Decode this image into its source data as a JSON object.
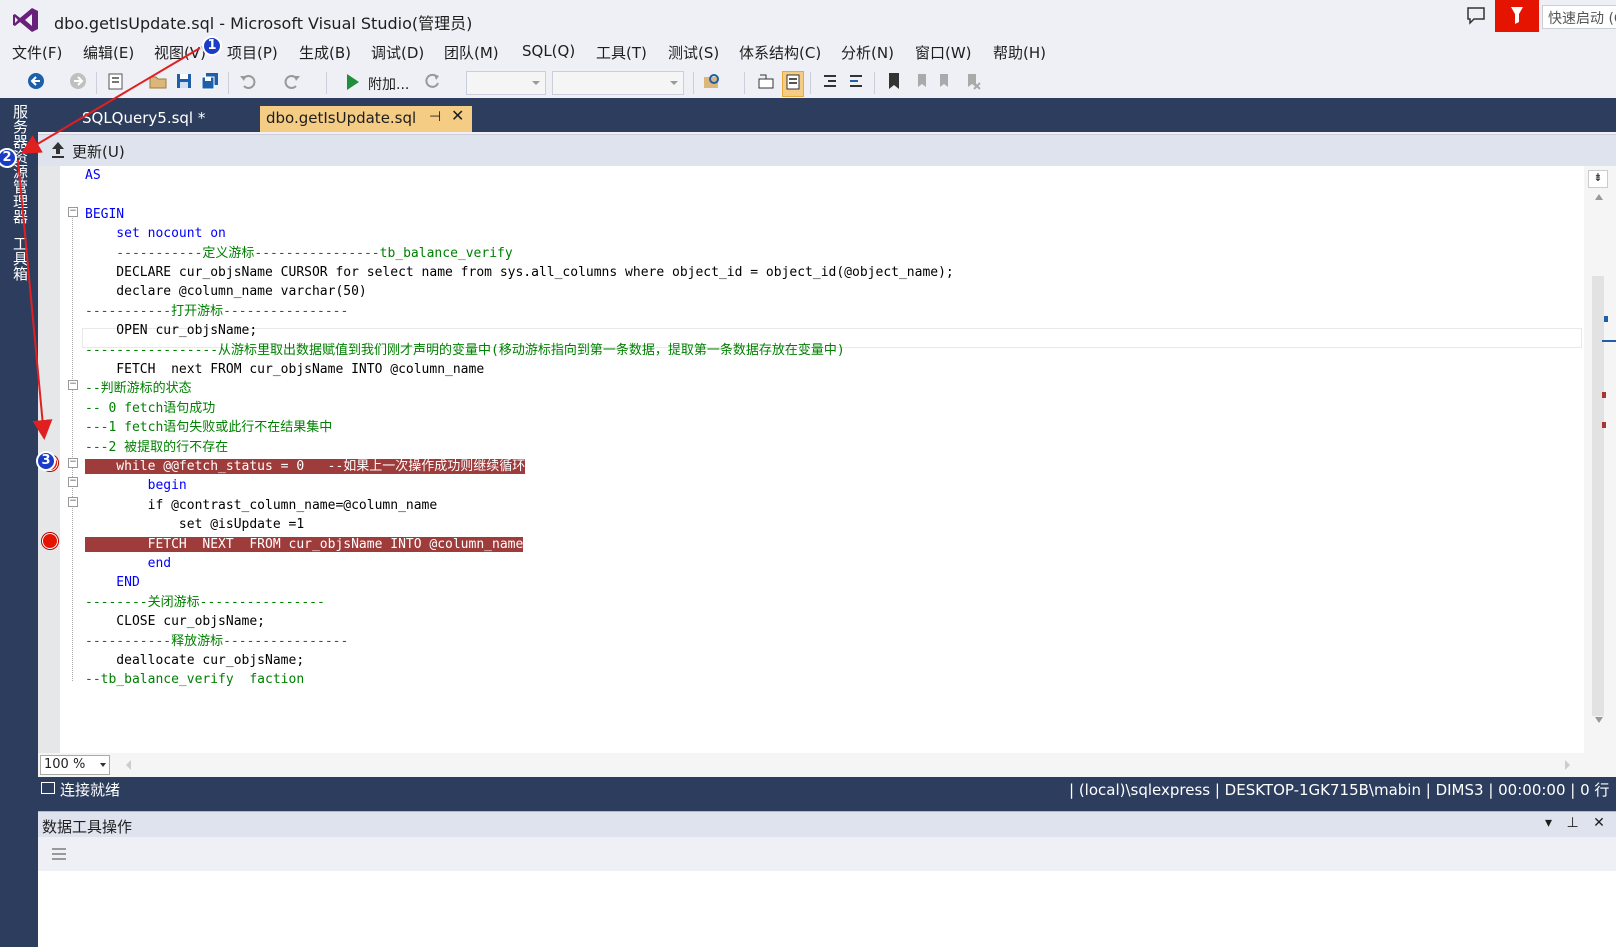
{
  "window": {
    "title": "dbo.getIsUpdate.sql  - Microsoft Visual Studio(管理员)"
  },
  "quick_launch": {
    "placeholder": "快速启动 (Ctrl+Q)"
  },
  "menu": [
    "文件(F)",
    "编辑(E)",
    "视图(V)",
    "项目(P)",
    "生成(B)",
    "调试(D)",
    "团队(M)",
    "SQL(Q)",
    "工具(T)",
    "测试(S)",
    "体系结构(C)",
    "分析(N)",
    "窗口(W)",
    "帮助(H)"
  ],
  "toolbar": {
    "attach_label": "附加..."
  },
  "side_tabs": {
    "server_explorer": "服务器资源管理器",
    "toolbox": "工具箱"
  },
  "tabs": {
    "inactive": "SQLQuery5.sql *",
    "active": "dbo.getIsUpdate.sql"
  },
  "update_bar": {
    "label": "更新(U)"
  },
  "code_lines": [
    "AS",
    "",
    "BEGIN",
    "    set nocount on",
    "    -----------定义游标----------------tb_balance_verify",
    "    DECLARE cur_objsName CURSOR for select name from sys.all_columns where object_id = object_id(@object_name);",
    "    declare @column_name varchar(50)",
    "-----------打开游标----------------",
    "    OPEN cur_objsName;",
    "-----------------从游标里取出数据赋值到我们刚才声明的变量中(移动游标指向到第一条数据，提取第一条数据存放在变量中)",
    "    FETCH  next FROM cur_objsName INTO @column_name",
    "--判断游标的状态",
    "-- 0 fetch语句成功",
    "---1 fetch语句失败或此行不在结果集中",
    "---2 被提取的行不存在",
    "    while @@fetch_status = 0   --如果上一次操作成功则继续循环",
    "        begin",
    "        if @contrast_column_name=@column_name",
    "            set @isUpdate =1",
    "        FETCH  NEXT  FROM cur_objsName INTO @column_name",
    "        end",
    "    END",
    "--------关闭游标----------------",
    "    CLOSE cur_objsName;",
    "-----------释放游标----------------",
    "    deallocate cur_objsName;",
    "--tb_balance_verify  faction"
  ],
  "zoom": {
    "value": "100 %"
  },
  "status": {
    "left": "连接就绪",
    "right": "| (local)\\sqlexpress | DESKTOP-1GK715B\\mabin | DIMS3 | 00:00:00 | 0 行"
  },
  "bottom_panel": {
    "title": "数据工具操作"
  },
  "annotations": [
    "1",
    "2",
    "3"
  ],
  "colors": {
    "accent_frame": "#2d3d5e",
    "active_tab": "#f5cc84",
    "breakpoint": "#e51400",
    "breakpoint_line": "#9e3c3c",
    "annotation_arrow": "#e02020",
    "annotation_badge": "#1a3cc8"
  }
}
